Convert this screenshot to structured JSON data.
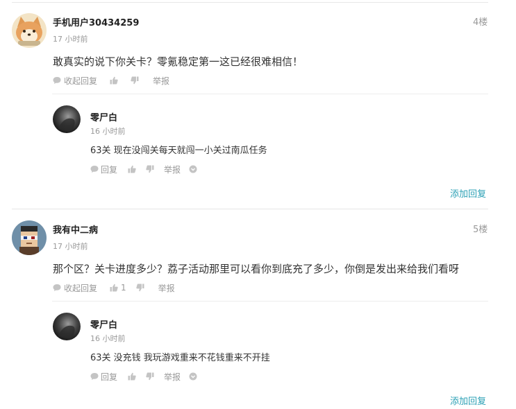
{
  "colors": {
    "link": "#2ba0b5",
    "muted": "#999999",
    "text": "#333333"
  },
  "comments": [
    {
      "username": "手机用户30434259",
      "floor": "4楼",
      "time": "17 小时前",
      "content": "敢真实的说下你关卡？零氪稳定第一这已经很难相信！",
      "actions": {
        "collapse": "收起回复",
        "like_count": "",
        "report": "举报"
      },
      "reply": {
        "username": "零尸白",
        "time": "16 小时前",
        "content": "63关 现在没闯关每天就闯一小关过南瓜任务",
        "actions": {
          "reply": "回复",
          "report": "举报"
        }
      },
      "add_reply": "添加回复"
    },
    {
      "username": "我有中二病",
      "floor": "5楼",
      "time": "17 小时前",
      "content": "那个区？关卡进度多少？荔子活动那里可以看你到底充了多少，你倒是发出来给我们看呀",
      "actions": {
        "collapse": "收起回复",
        "like_count": "1",
        "report": "举报"
      },
      "reply": {
        "username": "零尸白",
        "time": "16 小时前",
        "content": "63关 没充钱 我玩游戏重来不花钱重来不开挂",
        "actions": {
          "reply": "回复",
          "report": "举报"
        }
      },
      "add_reply": "添加回复"
    }
  ]
}
